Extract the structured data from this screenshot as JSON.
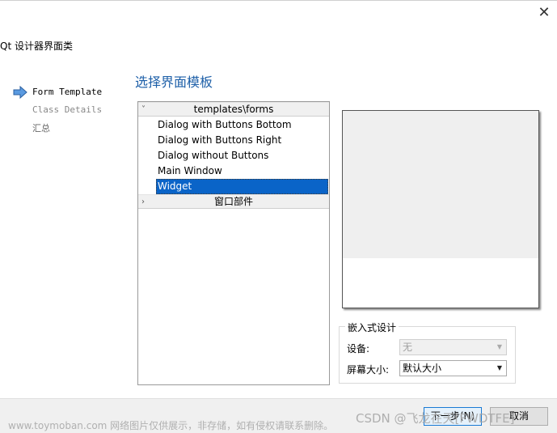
{
  "window": {
    "title": "Qt 设计器界面类"
  },
  "wizard_steps": [
    "Form Template",
    "Class Details",
    "汇总"
  ],
  "page_heading": "选择界面模板",
  "template_tree": {
    "category_1": "templates\\forms",
    "items": [
      "Dialog with Buttons Bottom",
      "Dialog with Buttons Right",
      "Dialog without Buttons",
      "Main Window",
      "Widget"
    ],
    "selected": "Widget",
    "category_2": "窗口部件"
  },
  "embedded_design": {
    "group_title": "嵌入式设计",
    "device_label": "设备:",
    "device_value": "无",
    "screen_label": "屏幕大小:",
    "screen_value": "默认大小"
  },
  "buttons": {
    "next": "下一步(N)",
    "cancel": "取消"
  },
  "watermarks": {
    "left": "www.toymoban.com 网络图片仅供展示，非存储，如有侵权请联系删除。",
    "right": "CSDN @飞龙在天[FWDTFE]"
  },
  "colors": {
    "heading": "#1d5fa8",
    "selection": "#0a64c8",
    "accent_button_border": "#1a7ad4"
  }
}
